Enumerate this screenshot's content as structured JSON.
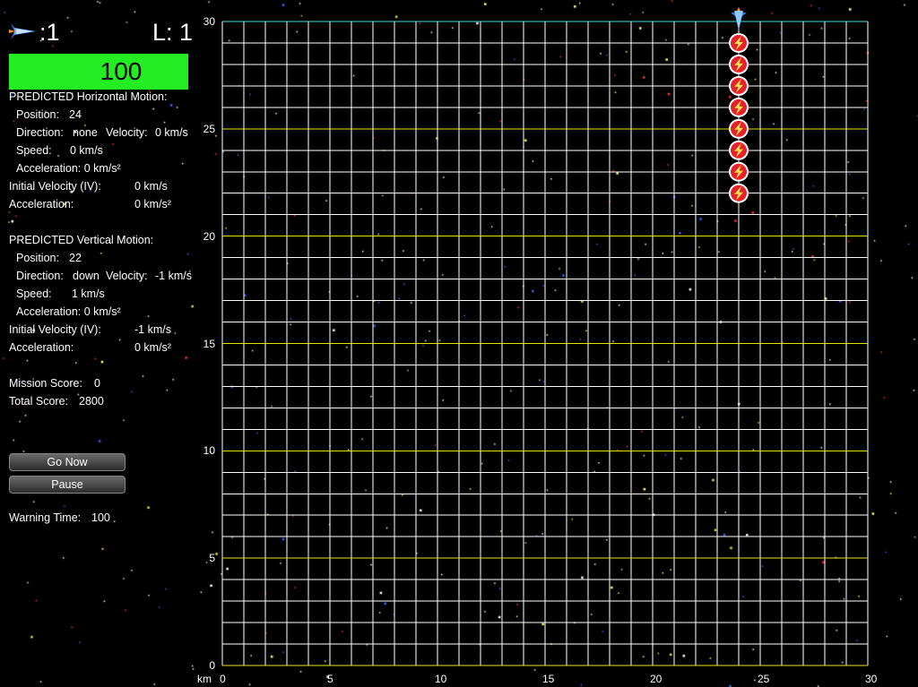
{
  "hud": {
    "ship_icon": "spaceship-icon",
    "lives_text": ":1",
    "level_text": "L: 1",
    "health_value": "100",
    "health_color": "#22ee22"
  },
  "horizontal": {
    "heading": "PREDICTED Horizontal Motion:",
    "position_label": "Position:",
    "position_value": "24",
    "direction_label": "Direction:",
    "direction_value": "none",
    "velocity_label": "Velocity:",
    "velocity_value": "0 km/s",
    "speed_label": "Speed:",
    "speed_value": "0 km/s",
    "acceleration_text": "Acceleration: 0 km/s²",
    "iv_label": "Initial Velocity (IV):",
    "iv_value": "0 km/s",
    "acc_label": "Acceleration:",
    "acc_value": "0 km/s²"
  },
  "vertical": {
    "heading": "PREDICTED Vertical Motion:",
    "position_label": "Position:",
    "position_value": "22",
    "direction_label": "Direction:",
    "direction_value": "down",
    "velocity_label": "Velocity:",
    "velocity_value": "-1 km/s",
    "speed_label": "Speed:",
    "speed_value": "1 km/s",
    "acceleration_text": "Acceleration: 0 km/s²",
    "iv_label": "Initial Velocity (IV):",
    "iv_value": "-1 km/s",
    "acc_label": "Acceleration:",
    "acc_value": "0 km/s²"
  },
  "scores": {
    "mission_label": "Mission Score:",
    "mission_value": "0",
    "total_label": "Total Score:",
    "total_value": "2800"
  },
  "controls": {
    "go_now": "Go Now",
    "pause": "Pause",
    "warning_label": "Warning Time:",
    "warning_value": "100"
  },
  "grid": {
    "unit_label": "km",
    "x_min": 0,
    "x_max": 30,
    "y_min": 0,
    "y_max": 30,
    "minor_step": 1,
    "major_step": 5,
    "x_ticks": [
      "0",
      "5",
      "10",
      "15",
      "20",
      "25",
      "30"
    ],
    "y_ticks": [
      "0",
      "5",
      "10",
      "15",
      "20",
      "25",
      "30"
    ],
    "minor_color": "#ffffff",
    "major_color": "#e6e600",
    "top_border_color": "#44dddd"
  },
  "game_objects": {
    "ship": {
      "x": 24,
      "y": 30,
      "icon": "spaceship-icon"
    },
    "predicted_path": {
      "x": 24,
      "y_points": [
        29,
        28,
        27,
        26,
        25,
        24,
        23,
        22
      ],
      "icon": "lightning-bolt-icon",
      "marker_color": "#e8202a"
    }
  }
}
